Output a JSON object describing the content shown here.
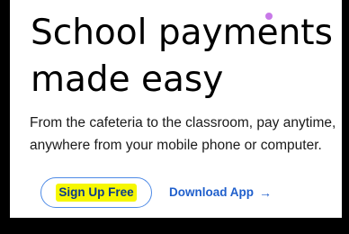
{
  "hero": {
    "headline_line1": "School payments",
    "headline_line2": "made easy",
    "subtext": "From the cafeteria to the classroom, pay anytime, anywhere from your mobile phone or computer.",
    "primary_cta_label": "Sign Up Free",
    "secondary_cta_label": "Download App",
    "secondary_cta_icon": "→"
  },
  "colors": {
    "primary_border": "#4f8be6",
    "highlight": "#f6f700",
    "link": "#1f5fcc"
  }
}
